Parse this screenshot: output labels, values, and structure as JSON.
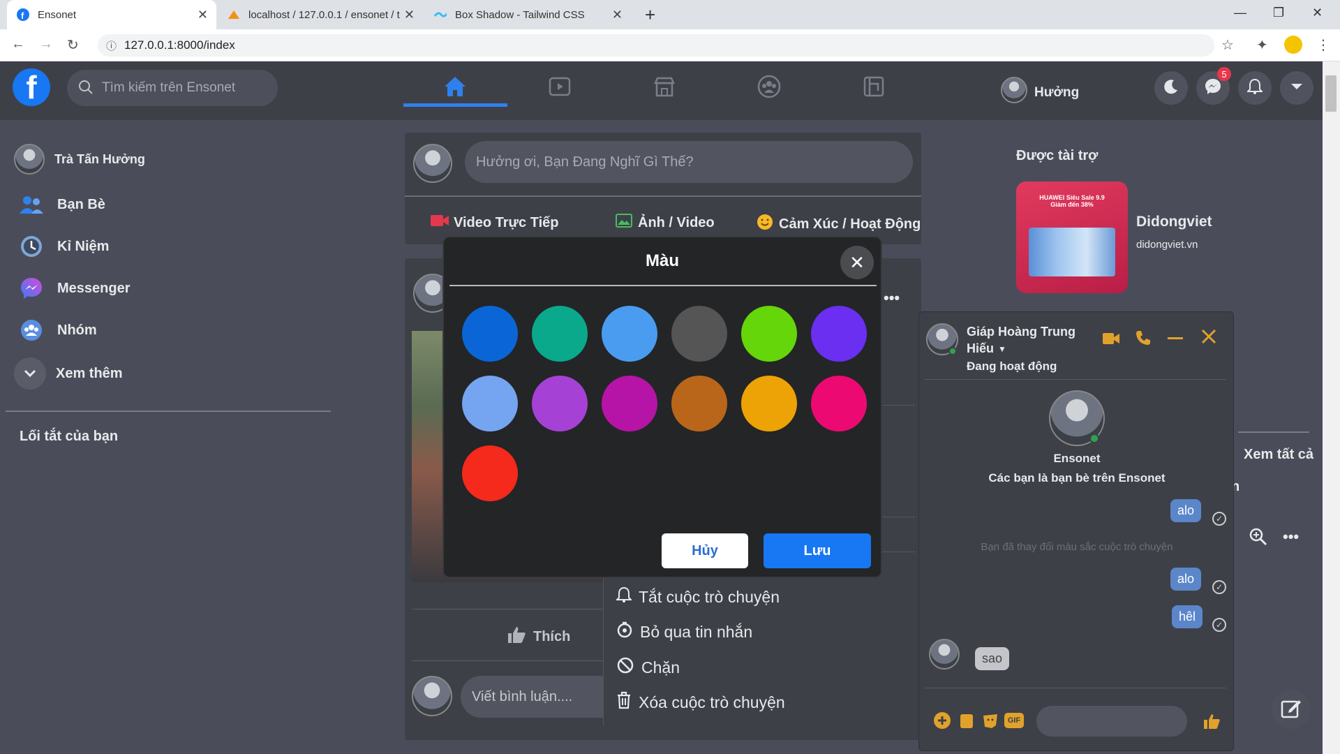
{
  "browser": {
    "tabs": [
      {
        "title": "Ensonet",
        "favicon": "facebook-icon"
      },
      {
        "title": "localhost / 127.0.0.1 / ensonet / t",
        "favicon": "phpmyadmin-icon"
      },
      {
        "title": "Box Shadow - Tailwind CSS",
        "favicon": "tailwind-icon"
      }
    ],
    "new_tab": "+",
    "url": "127.0.0.1:8000/index"
  },
  "header": {
    "logo": "f",
    "search_placeholder": "Tìm kiếm trên Ensonet",
    "user_name": "Hưởng",
    "messenger_badge": "5"
  },
  "sidebar": {
    "profile_name": "Trà Tấn Hưởng",
    "items": [
      {
        "label": "Bạn Bè",
        "icon": "friends-icon"
      },
      {
        "label": "Kỉ Niệm",
        "icon": "memories-icon"
      },
      {
        "label": "Messenger",
        "icon": "messenger-icon"
      },
      {
        "label": "Nhóm",
        "icon": "groups-icon"
      },
      {
        "label": "Xem thêm",
        "icon": "chevron-down-icon"
      }
    ],
    "shortcuts_title": "Lối tắt của bạn"
  },
  "composer": {
    "placeholder": "Hưởng ơi, Bạn Đang Nghĩ Gì Thế?",
    "actions": [
      "Video Trực Tiếp",
      "Ảnh / Video",
      "Cảm Xúc / Hoạt Động"
    ]
  },
  "post": {
    "like_label": "Thích",
    "comment_placeholder": "Viết bình luận...."
  },
  "context_menu": {
    "items": [
      "Tắt cuộc trò chuyện",
      "Bỏ qua tin nhắn",
      "Chặn",
      "Xóa cuộc trò chuyện"
    ]
  },
  "color_modal": {
    "title": "Màu",
    "colors": [
      "#0a66d6",
      "#0aa98c",
      "#4a9cf0",
      "#555555",
      "#65d60a",
      "#6a2ff0",
      "#75a4f0",
      "#a641d6",
      "#b514a6",
      "#b9661a",
      "#eda305",
      "#ec0a72",
      "#f5291c"
    ],
    "cancel_label": "Hủy",
    "save_label": "Lưu"
  },
  "sponsored": {
    "title": "Được tài trợ",
    "ad_name": "Didongviet",
    "ad_url": "didongviet.vn",
    "ad_image_text": "HUAWEI Siêu Sale 9.9 Giảm đến 38%"
  },
  "right_misc": {
    "see_all": "Xem tất cả",
    "partial_letter": "n"
  },
  "chat": {
    "name_line1": "Giáp Hoàng Trung",
    "name_line2": "Hiếu",
    "status": "Đang hoạt động",
    "profile_name": "Ensonet",
    "profile_sub": "Các bạn là bạn bè trên Ensonet",
    "messages": [
      {
        "text": "alo",
        "side": "me"
      },
      {
        "text": "Bạn đã thay đổi màu sắc cuộc trò chuyện",
        "side": "system"
      },
      {
        "text": "alo",
        "side": "me"
      },
      {
        "text": "hêl",
        "side": "me"
      },
      {
        "text": "sao",
        "side": "them"
      }
    ],
    "gif_label": "GIF"
  }
}
